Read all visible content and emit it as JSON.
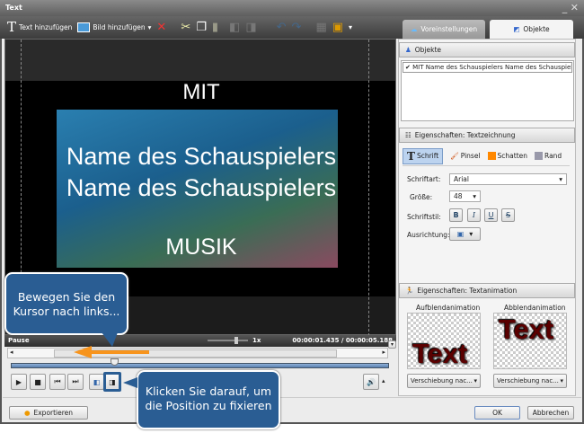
{
  "window": {
    "title": "Text",
    "controls": "_ ✕"
  },
  "toolbar": {
    "add_text": "Text hinzufügen",
    "add_image": "Bild hinzufügen"
  },
  "tabs": {
    "presets": "Voreinstellungen",
    "objects": "Objekte"
  },
  "preview": {
    "line1": "MIT",
    "line2": "Name des Schauspielers",
    "line3": "Name des Schauspielers",
    "line4": "MUSIK"
  },
  "status": {
    "state": "Pause",
    "speed": "1x",
    "time": "00:00:01.435 / 00:00:05.188"
  },
  "objects": {
    "header": "Objekte",
    "items": [
      {
        "checked": true,
        "label": "MIT  Name des Schauspielers Name des Schauspieler."
      }
    ]
  },
  "text_props": {
    "header": "Eigenschaften: Textzeichnung",
    "tabs": [
      "Schrift",
      "Pinsel",
      "Schatten",
      "Rand"
    ],
    "font_label": "Schriftart:",
    "font_value": "Arial",
    "size_label": "Größe:",
    "size_value": "48",
    "style_label": "Schriftstil:",
    "style_buttons": [
      "B",
      "I",
      "U",
      "S"
    ],
    "align_label": "Ausrichtung:"
  },
  "anim_props": {
    "header": "Eigenschaften: Textanimation",
    "in_label": "Aufblendanimation",
    "out_label": "Abblendanimation",
    "preview_text": "Text",
    "in_value": "Verschiebung nac...",
    "out_value": "Verschiebung nac..."
  },
  "footer": {
    "export": "Exportieren",
    "ok": "OK",
    "cancel": "Abbrechen"
  },
  "callouts": {
    "move": "Bewegen Sie den Kursor nach links...",
    "click": "Klicken Sie darauf, um die Position zu fixieren"
  },
  "colors": {
    "callout": "#2a5d93",
    "arrow": "#f7941d"
  }
}
